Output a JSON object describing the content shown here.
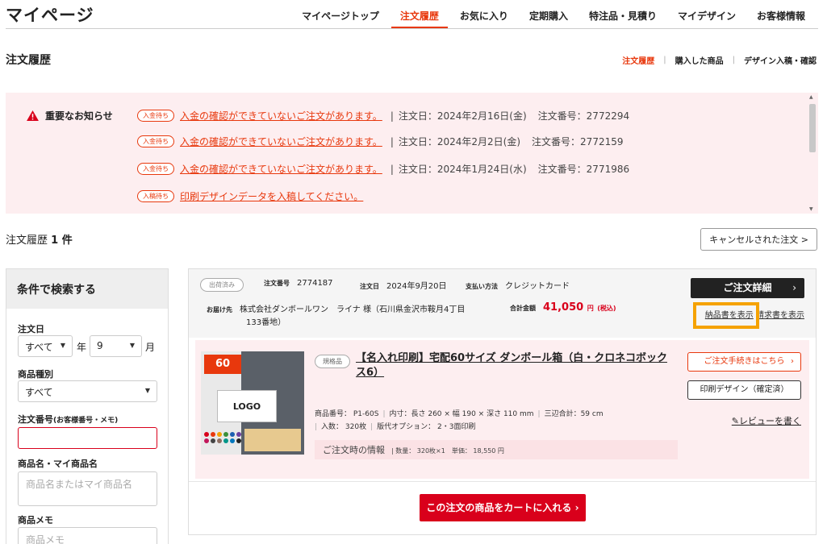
{
  "header": {
    "title": "マイページ",
    "nav": [
      {
        "label": "マイページトップ",
        "active": false
      },
      {
        "label": "注文履歴",
        "active": true
      },
      {
        "label": "お気に入り",
        "active": false
      },
      {
        "label": "定期購入",
        "active": false
      },
      {
        "label": "特注品・見積り",
        "active": false
      },
      {
        "label": "マイデザイン",
        "active": false
      },
      {
        "label": "お客様情報",
        "active": false
      }
    ]
  },
  "page": {
    "title": "注文履歴",
    "subnav": [
      "注文履歴",
      "購入した商品",
      "デザイン入稿・確認"
    ]
  },
  "notice": {
    "label": "重要なお知らせ",
    "rows": [
      {
        "pill": "入金待ち",
        "link": "入金の確認ができていないご注文があります。",
        "bar": "|",
        "date": "注文日：2024年2月16日(金)",
        "order": "注文番号：2772294"
      },
      {
        "pill": "入金待ち",
        "link": "入金の確認ができていないご注文があります。",
        "bar": "|",
        "date": "注文日：2024年2月2日(金)",
        "order": "注文番号：2772159"
      },
      {
        "pill": "入金待ち",
        "link": "入金の確認ができていないご注文があります。",
        "bar": "|",
        "date": "注文日：2024年1月24日(水)",
        "order": "注文番号：2771986"
      },
      {
        "pill": "入稿待ち",
        "link": "印刷デザインデータを入稿してください。",
        "bar": "",
        "date": "",
        "order": ""
      }
    ]
  },
  "history": {
    "label": "注文履歴",
    "count": "1 件",
    "cancel_label": "キャンセルされた注文 >"
  },
  "search": {
    "title": "条件で検索する",
    "date_label": "注文日",
    "year_value": "すべて",
    "year_unit": "年",
    "month_value": "9",
    "month_unit": "月",
    "type_label": "商品種別",
    "type_value": "すべて",
    "order_no_label": "注文番号",
    "order_no_hint": "(お客様番号・メモ)",
    "product_label": "商品名・マイ商品名",
    "product_placeholder": "商品名またはマイ商品名",
    "memo_label": "商品メモ",
    "memo_placeholder": "商品メモ"
  },
  "order": {
    "status": "出荷済み",
    "order_no_label": "注文番号",
    "order_no": "2774187",
    "date_label": "注文日",
    "date": "2024年9月20日",
    "payment_label": "支払い方法",
    "payment": "クレジットカード",
    "ship_label": "お届け先",
    "ship_to_line1": "株式会社ダンボールワン　ライナ 様（石川県金沢市鞍月4丁目",
    "ship_to_line2": "133番地）",
    "total_label": "合計金額",
    "total": "41,050",
    "total_unit": "円",
    "total_tax": "(税込)",
    "detail_label": "ご注文詳細",
    "delivery_note_label": "納品書を表示",
    "invoice_label": "請求書を表示",
    "item": {
      "tag": "規格品",
      "name": "【名入れ印刷】宅配60サイズ ダンボール箱（白・クロネコボックス6）",
      "spec1": [
        "商品番号： P1-60S",
        "内寸：長さ 260 × 幅 190 × 深さ 110 mm",
        "三辺合計：59 cm"
      ],
      "spec2": [
        "入数： 320枚",
        "版代オプション： 2・3面印刷"
      ],
      "info_label": "ご注文時の情報",
      "info_qty": "数量： 320枚×1",
      "info_price": "単価： 18,550 円",
      "proc_label": "ご注文手続きはこちら",
      "print_label": "印刷デザイン（確定済）",
      "review_label": "レビューを書く",
      "thumb_badge": "60",
      "thumb_logo": "LOGO"
    },
    "cart_label": "この注文の商品をカートに入れる"
  },
  "colors": {
    "accent": "#e8380d",
    "notice_bg": "#fdeef0",
    "cart": "#d9001b",
    "highlight": "#f5a200"
  }
}
